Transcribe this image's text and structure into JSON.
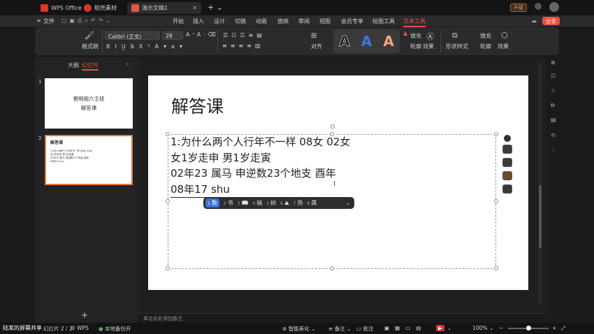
{
  "titlebar": {
    "tabs": [
      {
        "label": "WPS Office"
      },
      {
        "label": "稻壳素材"
      },
      {
        "label": "演示文稿1"
      }
    ],
    "upgrade_label": "升级"
  },
  "menubar": {
    "file_label": "文件",
    "items": [
      "开始",
      "插入",
      "设计",
      "切换",
      "动画",
      "放映",
      "审阅",
      "视图",
      "会员专享",
      "绘图工具",
      "文本工具"
    ],
    "share_label": "分享"
  },
  "ribbon": {
    "format_painter": "格式刷",
    "font_name": "Calibri (正文)",
    "font_size": "28",
    "align_label": "对齐",
    "fill_label": "填充",
    "outline_label": "轮廓",
    "effect_label": "效果",
    "shape_style_label": "形状样式",
    "fill2_label": "填充",
    "outline2_label": "轮廓",
    "effect2_label": "效果"
  },
  "left_panel": {
    "tab_outline": "大纲",
    "tab_slides": "幻灯片",
    "slide1_num": "1",
    "slide1_line1": "晋明阁六壬班",
    "slide1_line2": "解答课",
    "slide2_num": "2",
    "slide2_title": "解答课",
    "slide2_body": "1:为什么两个人行年不一样 08女 02女\n女1岁走申 男1岁走寅\n02年23 属马 申逆数23个地支 酉年\n08年17 shu"
  },
  "slide": {
    "title": "解答课",
    "lines": [
      "1:为什么两个人行年不一样 08女 02女",
      "女1岁走申 男1岁走寅",
      "02年23 属马 申逆数23个地支 酉年",
      "08年17 shu"
    ]
  },
  "ime": {
    "candidates": [
      {
        "n": "1",
        "t": "数"
      },
      {
        "n": "2",
        "t": "书"
      },
      {
        "n": "3",
        "t": "📖"
      },
      {
        "n": "4",
        "t": "输"
      },
      {
        "n": "5",
        "t": "树"
      },
      {
        "n": "6",
        "t": "⛰"
      },
      {
        "n": "7",
        "t": "熟"
      },
      {
        "n": "8",
        "t": "属"
      }
    ]
  },
  "notes_placeholder": "单击此处添加备注",
  "statusbar": {
    "screen_share": "陆某的屏幕共享",
    "slide_counter": "幻灯片 2 / 2",
    "wps_label": "WPS",
    "backup_label": "本地备份开",
    "beautify_label": "智能美化",
    "notes_label": "备注",
    "comments_label": "批注",
    "zoom": "100%"
  },
  "colors": {
    "accent": "#e8523f",
    "selected_border": "#e07a3a"
  }
}
